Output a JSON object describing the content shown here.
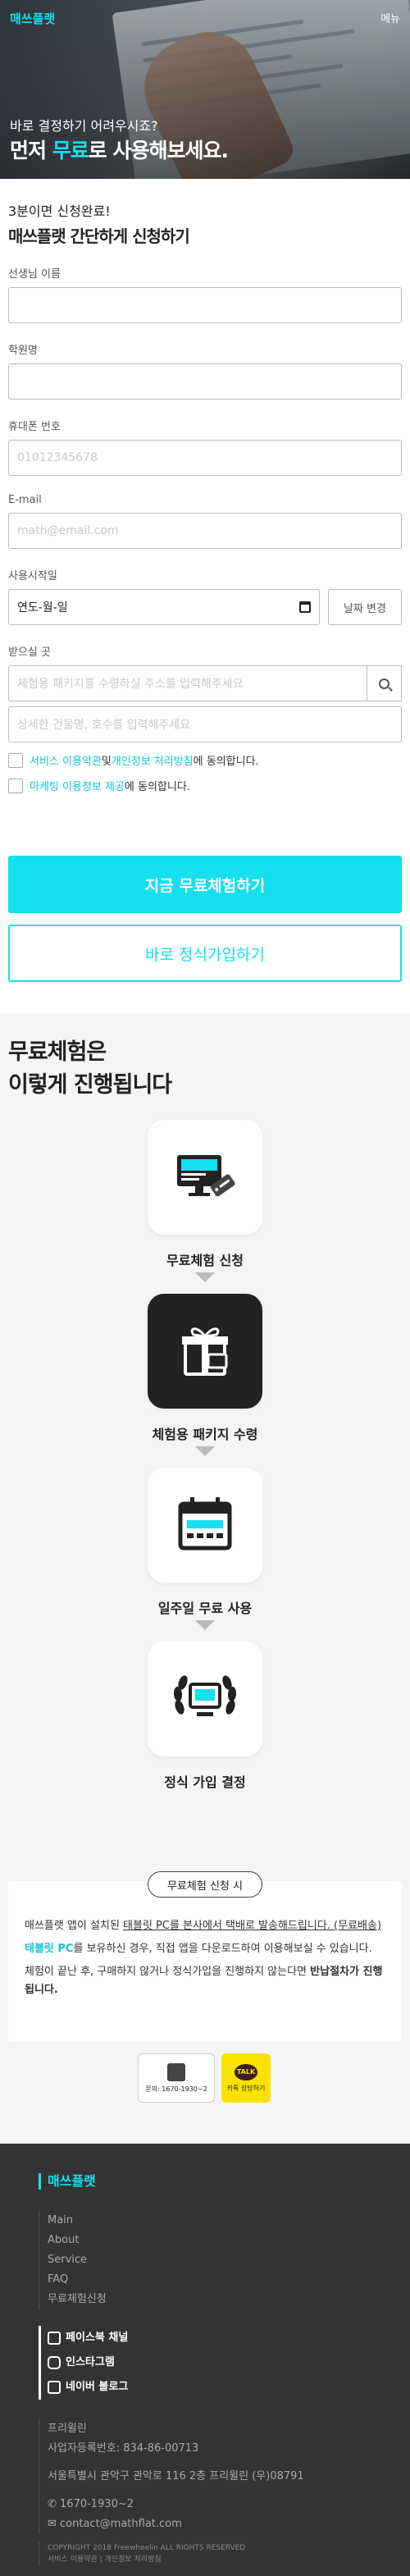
{
  "header": {
    "logo": "매쓰플랫",
    "menu": "메뉴"
  },
  "hero": {
    "subtitle": "바로 결정하기 어려우시죠?",
    "title_prefix": "먼저 ",
    "title_highlight": "무료",
    "title_suffix": "로 사용해보세요."
  },
  "form": {
    "subtitle": "3분이면 신청완료!",
    "title": "매쓰플랫 간단하게 신청하기",
    "teacher_label": "선생님 이름",
    "academy_label": "학원명",
    "phone_label": "휴대폰 번호",
    "phone_placeholder": "01012345678",
    "email_label": "E-mail",
    "email_placeholder": "math@email.com",
    "start_label": "사용시작일",
    "date_value": "연도-월-일",
    "date_change": "날짜 변경",
    "addr_label": "받으실 곳",
    "addr_placeholder": "체험용 패키지를 수령하실 주소를 입력해주세요",
    "addr_detail_placeholder": "상세한 건물명, 호수를 입력해주세요",
    "agree1_link1": "서비스 이용약관",
    "agree1_mid": " 및 ",
    "agree1_link2": "개인정보 처리방침",
    "agree1_suffix": "에 동의합니다.",
    "agree2_link": "마케팅 이용정보 제공",
    "agree2_suffix": "에 동의합니다.",
    "submit": "지금 무료체험하기",
    "signup": "바로 정식가입하기"
  },
  "process": {
    "title_line1": "무료체험은",
    "title_line2": "이렇게 진행됩니다",
    "steps": [
      {
        "label": "무료체험 신청",
        "icon": "computer-tag-icon"
      },
      {
        "label": "체험용 패키지 수령",
        "icon": "gift-box-icon"
      },
      {
        "label": "일주일 무료 사용",
        "icon": "calendar-icon"
      },
      {
        "label": "정식 가입 결정",
        "icon": "tablet-laurel-icon"
      }
    ],
    "note_pill": "무료체험 신청 시",
    "note1_pre": "매쓰플랫 앱이 설치된 ",
    "note1_link": "태블릿 PC를 본사에서 택배로 발송해드립니다. (무료배송)",
    "note2_hl": "태블릿 PC",
    "note2_rest": "를 보유하신 경우, 직접 앱을 다운로드하여 이용해보실 수 있습니다.",
    "note3_pre": "체험이 끝난 후, 구매하지 않거나 정식가입을 진행하지 않는다면 ",
    "note3_bold": "반납절차가 진행됩니다.",
    "call_label": "문의: 1670-1930~2",
    "kakao_talk": "TALK",
    "kakao_label": "카톡 상담하기"
  },
  "footer": {
    "logo": "매쓰플랫",
    "menu": [
      "Main",
      "About",
      "Service",
      "FAQ",
      "무료체험신청"
    ],
    "social": [
      "페이스북 채널",
      "인스타그램",
      "네이버 블로그"
    ],
    "company": "프리윌린",
    "biz": "사업자등록번호: 834-86-00713",
    "address": "서울특별시 관악구 관악로 116 2층 프리윌린 (우)08791",
    "phone": "1670-1930~2",
    "email": "contact@mathflat.com",
    "copyright": "COPYRIGHT 2018 Freewheelin ALL RIGHTS RESERVED",
    "terms": "서비스 이용약관 | 개인정보 처리방침"
  },
  "colors": {
    "accent": "#14E0F0",
    "footer_bg": "#333333",
    "process_bg": "#F4F5F6",
    "kakao": "#FBE100"
  }
}
